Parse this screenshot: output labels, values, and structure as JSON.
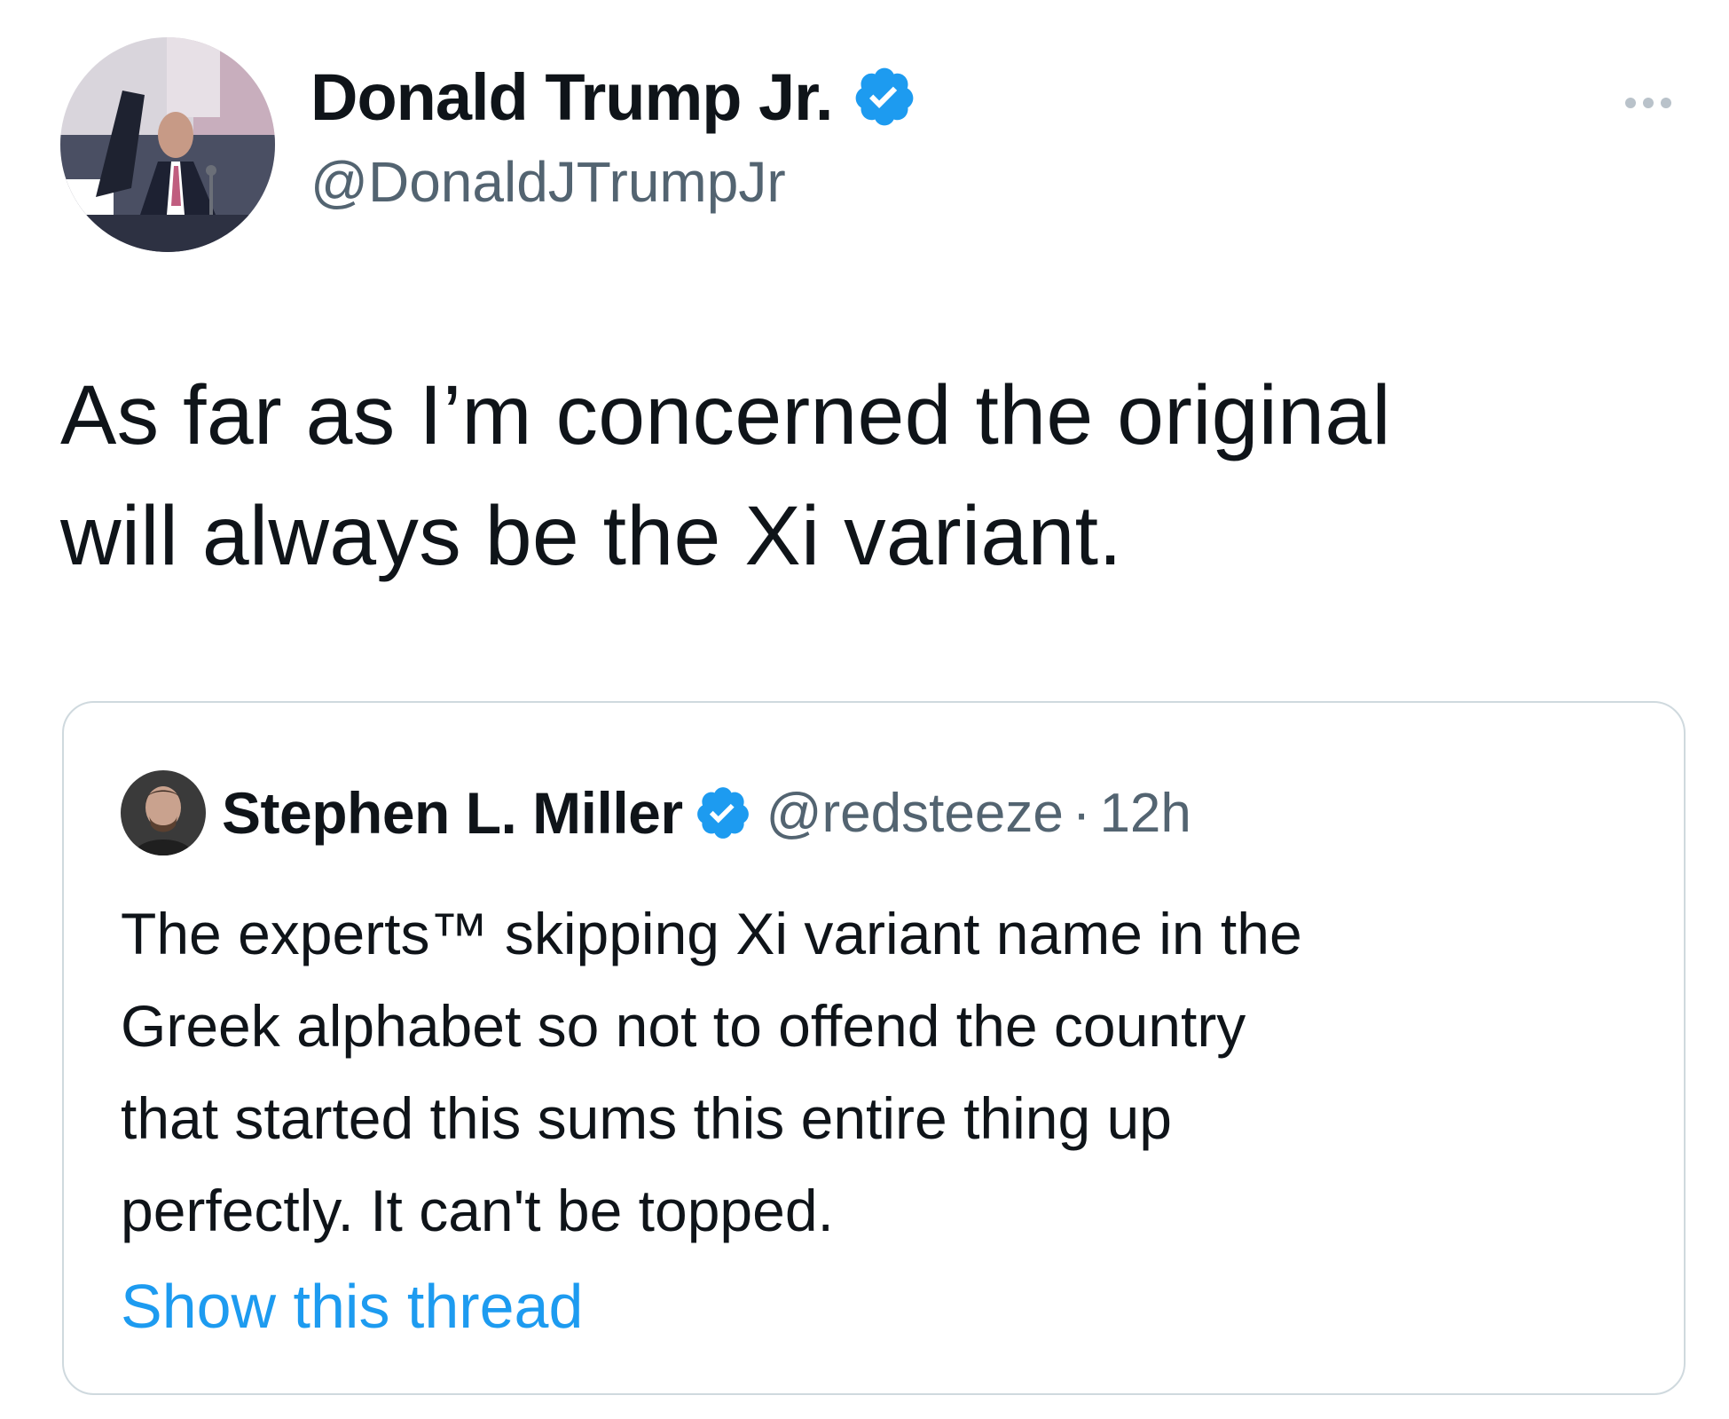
{
  "tweet": {
    "author": {
      "display_name": "Donald Trump Jr.",
      "handle": "@DonaldJTrumpJr",
      "verified": true,
      "avatar_icon": "profile-photo"
    },
    "more_icon": "more-horizontal-icon",
    "text": "As far as I’m concerned the original\nwill always be the Xi variant."
  },
  "quoted_tweet": {
    "author": {
      "display_name": "Stephen L. Miller",
      "handle": "@redsteeze",
      "verified": true,
      "avatar_icon": "profile-photo"
    },
    "separator": "·",
    "timestamp": "12h",
    "text": "The experts™ skipping Xi variant name in the\nGreek alphabet so not to offend the country\nthat started this sums this entire thing up\nperfectly. It can't be topped.",
    "show_thread_label": "Show this thread"
  },
  "colors": {
    "text_primary": "#0f1419",
    "text_secondary": "#536471",
    "link": "#1d9bf0",
    "verified_badge": "#1d9bf0",
    "card_border": "#cfd9de"
  }
}
